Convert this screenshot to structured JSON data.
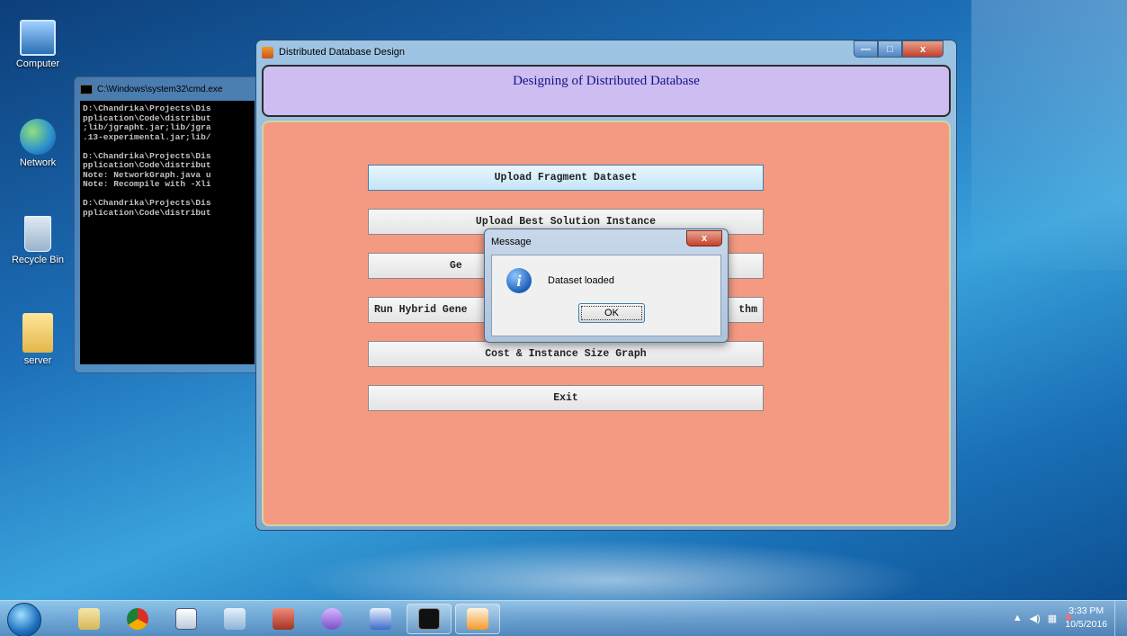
{
  "desktop": {
    "icons": [
      {
        "label": "Computer"
      },
      {
        "label": "Network"
      },
      {
        "label": "Recycle Bin"
      },
      {
        "label": "server"
      }
    ]
  },
  "cmd_window": {
    "title": "C:\\Windows\\system32\\cmd.exe",
    "lines": "D:\\Chandrika\\Projects\\Dis\npplication\\Code\\distribut\n;lib/jgrapht.jar;lib/jgra\n.13-experimental.jar;lib/\n\nD:\\Chandrika\\Projects\\Dis\npplication\\Code\\distribut\nNote: NetworkGraph.java u\nNote: Recompile with -Xli\n\nD:\\Chandrika\\Projects\\Dis\npplication\\Code\\distribut"
  },
  "app_window": {
    "title": "Distributed Database Design",
    "controls": {
      "minimize": "—",
      "maximize": "□",
      "close": "x"
    },
    "heading": "Designing of Distributed Database",
    "buttons": [
      {
        "label": "Upload Fragment Dataset"
      },
      {
        "label": "Upload Best Solution Instance"
      },
      {
        "label": "Ge"
      },
      {
        "label": "Run Hybrid Gene",
        "label_tail": "thm"
      },
      {
        "label": "Cost & Instance Size Graph"
      },
      {
        "label": "Exit"
      }
    ]
  },
  "dialog": {
    "title": "Message",
    "close": "x",
    "icon_glyph": "i",
    "message": "Dataset loaded",
    "ok_label": "OK"
  },
  "taskbar": {
    "items": [
      "explorer-icon",
      "chrome-icon",
      "box-icon",
      "search-doc-icon",
      "app-icon",
      "dolphin-icon",
      "word-icon",
      "cmd-icon",
      "java-icon"
    ],
    "tray_glyphs": {
      "arrow": "▲",
      "volume": "◀)",
      "network": "▦",
      "flag": "⚑"
    },
    "time": "3:33 PM",
    "date": "10/5/2016"
  }
}
